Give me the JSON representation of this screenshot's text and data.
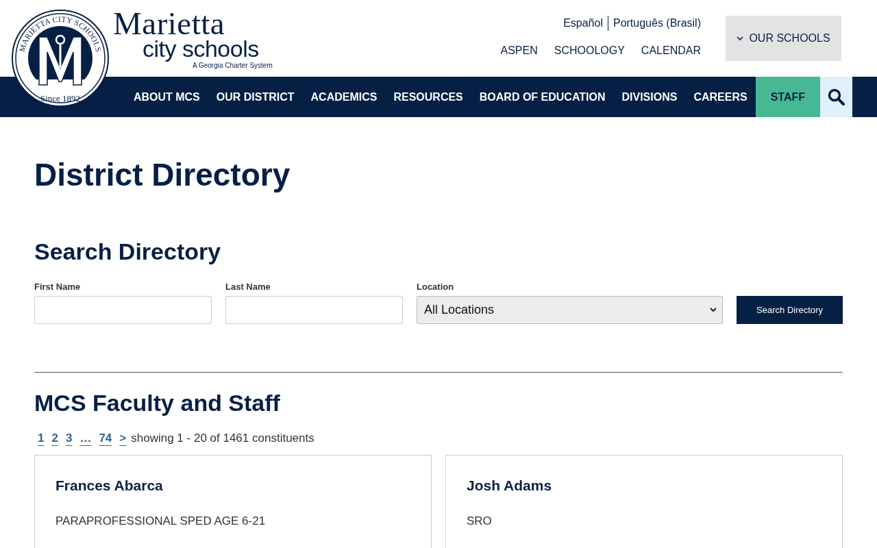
{
  "header": {
    "seal": {
      "ring_text": "MARIETTA CITY SCHOOLS",
      "year_text": "Since 1892"
    },
    "wordmark": {
      "name": "Marietta",
      "subname": "city schools",
      "tagline": "A Georgia Charter System"
    },
    "languages": [
      "Español",
      "Português (Brasil)"
    ],
    "quick_links": [
      "ASPEN",
      "SCHOOLOGY",
      "CALENDAR"
    ],
    "schools_button": "OUR SCHOOLS"
  },
  "nav": {
    "items": [
      {
        "label": "ABOUT MCS",
        "kind": "link"
      },
      {
        "label": "OUR DISTRICT",
        "kind": "link"
      },
      {
        "label": "ACADEMICS",
        "kind": "link"
      },
      {
        "label": "RESOURCES",
        "kind": "link"
      },
      {
        "label": "BOARD OF EDUCATION",
        "kind": "link"
      },
      {
        "label": "DIVISIONS",
        "kind": "link"
      },
      {
        "label": "CAREERS",
        "kind": "link"
      },
      {
        "label": "STAFF",
        "kind": "highlight"
      }
    ]
  },
  "page_title": "District Directory",
  "search": {
    "title": "Search Directory",
    "fields": [
      {
        "label": "First Name",
        "kind": "text"
      },
      {
        "label": "Last Name",
        "kind": "text"
      },
      {
        "label": "Location",
        "kind": "select",
        "value": "All Locations"
      }
    ],
    "button": "Search Directory"
  },
  "results": {
    "title": "MCS Faculty and Staff",
    "pages": [
      "1",
      "2",
      "3",
      "…",
      "74",
      ">"
    ],
    "summary": "showing 1 - 20 of 1461 constituents",
    "cards": [
      {
        "name": "Frances Abarca",
        "role": "PARAPROFESSIONAL SPED AGE 6-21"
      },
      {
        "name": "Josh Adams",
        "role": "SRO"
      }
    ]
  }
}
